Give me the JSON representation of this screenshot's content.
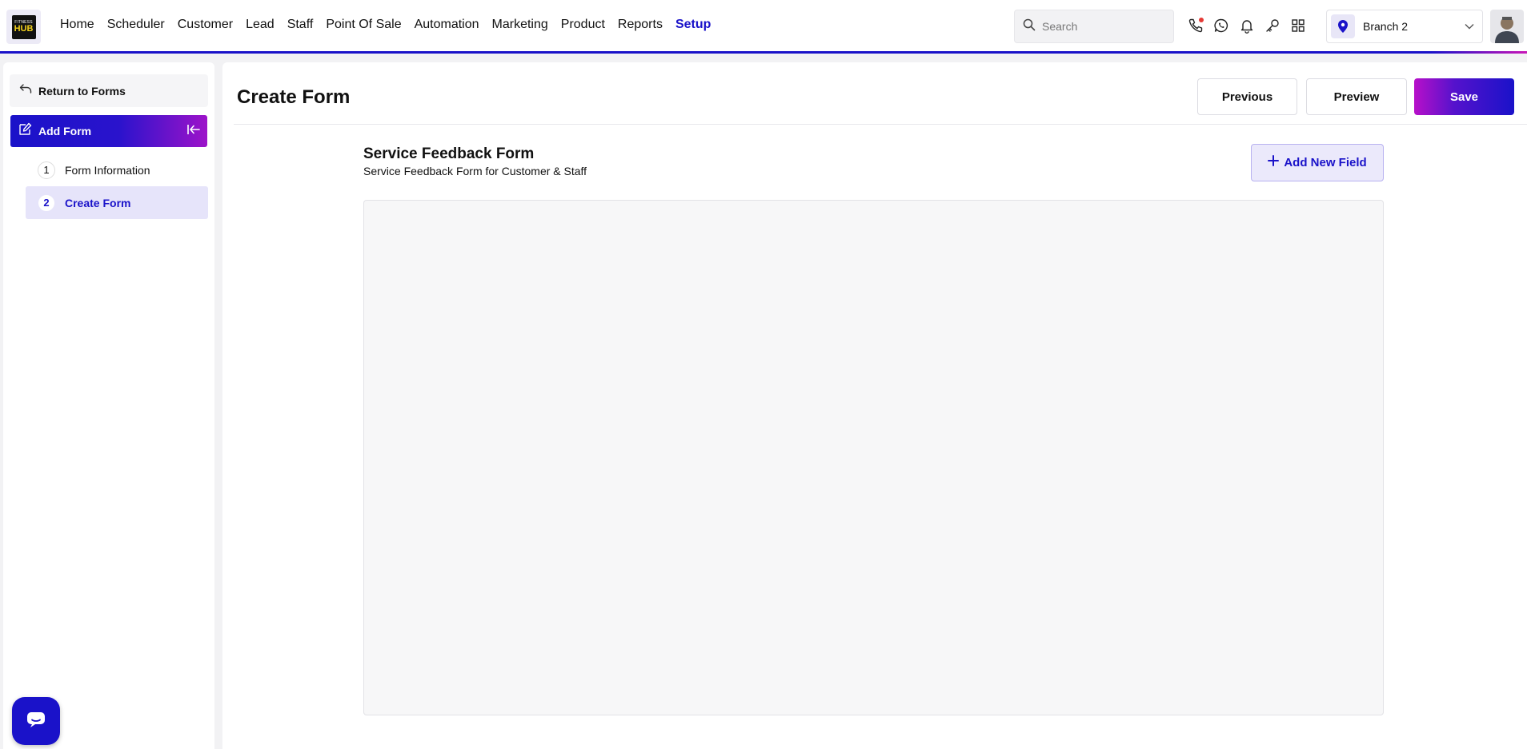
{
  "brand": {
    "logo_top": "FITNESS",
    "logo_bottom": "HUB"
  },
  "nav": {
    "items": [
      {
        "label": "Home",
        "active": false
      },
      {
        "label": "Scheduler",
        "active": false
      },
      {
        "label": "Customer",
        "active": false
      },
      {
        "label": "Lead",
        "active": false
      },
      {
        "label": "Staff",
        "active": false
      },
      {
        "label": "Point Of Sale",
        "active": false
      },
      {
        "label": "Automation",
        "active": false
      },
      {
        "label": "Marketing",
        "active": false
      },
      {
        "label": "Product",
        "active": false
      },
      {
        "label": "Reports",
        "active": false
      },
      {
        "label": "Setup",
        "active": true
      }
    ]
  },
  "search": {
    "placeholder": "Search",
    "value": ""
  },
  "toolbar_icons": [
    "phone-icon",
    "whatsapp-icon",
    "bell-icon",
    "key-icon",
    "apps-grid-icon"
  ],
  "branch": {
    "label": "Branch 2"
  },
  "sidebar": {
    "return_label": "Return to Forms",
    "section_title": "Add Form",
    "steps": [
      {
        "number": "1",
        "label": "Form Information",
        "active": false
      },
      {
        "number": "2",
        "label": "Create Form",
        "active": true
      }
    ]
  },
  "main": {
    "page_title": "Create Form",
    "buttons": {
      "previous": "Previous",
      "preview": "Preview",
      "save": "Save"
    },
    "form": {
      "name": "Service Feedback Form",
      "description": "Service Feedback Form for Customer & Staff"
    },
    "add_field_label": "Add New Field"
  },
  "colors": {
    "primary": "#1a12c9",
    "accent": "#b810c9",
    "active_step_bg": "#e6e4fa"
  }
}
